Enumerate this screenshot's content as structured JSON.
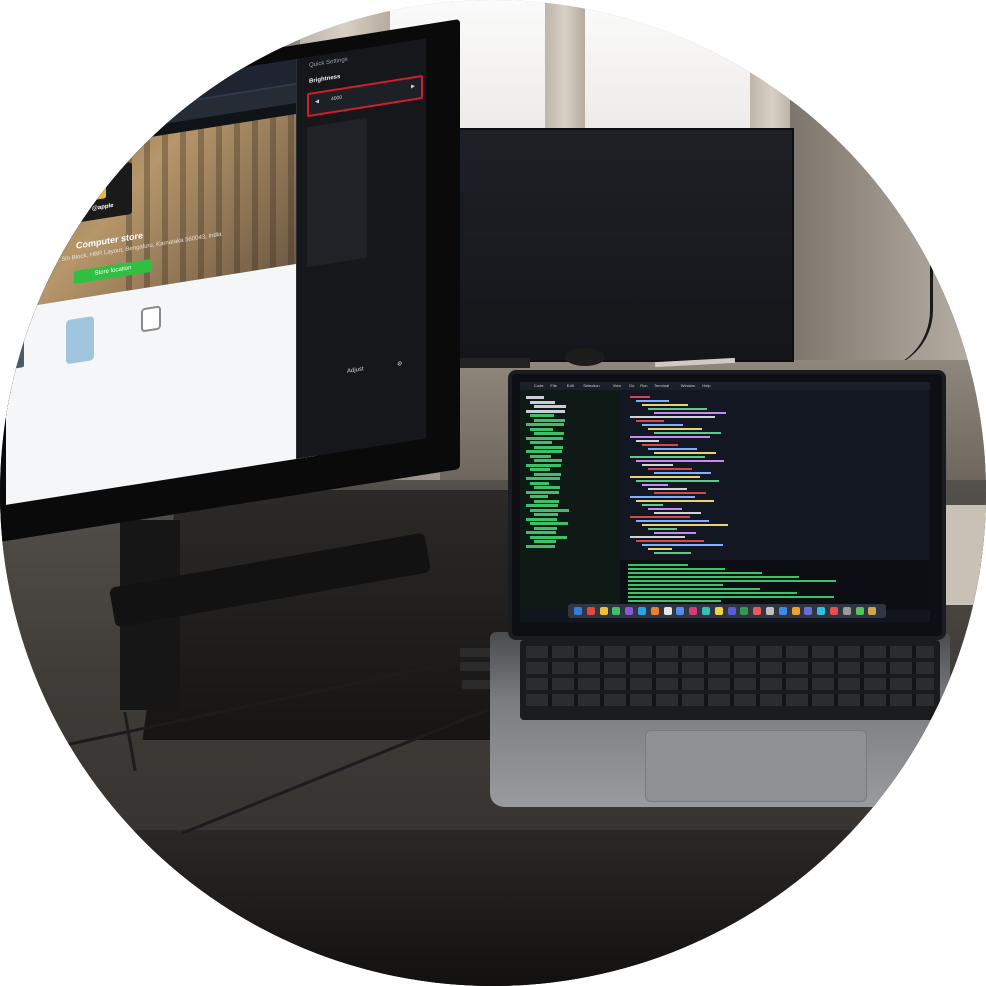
{
  "image": {
    "type": "photo"
  },
  "left_monitor": {
    "browser_tab_label": "Setting",
    "hero": {
      "brand": "@apple",
      "title": "Computer store",
      "address": "31, 4th Main Rd, 5th Block, HBR Layout, Bengaluru, Karnataka 560043, India",
      "button_label": "Store location"
    },
    "quick_settings": {
      "title": "Quick Settings",
      "label": "Brightness",
      "slider_value": "4000",
      "slider_left_icon": "chevron-left-icon",
      "slider_right_icon": "chevron-right-icon",
      "footer_text": "Adjust"
    }
  },
  "laptop": {
    "menu_items": [
      "Code",
      "File",
      "Edit",
      "Selection",
      "View",
      "Go",
      "Run",
      "Terminal",
      "Window",
      "Help"
    ],
    "dock_icon_colors": [
      "#2e7de1",
      "#e24b3b",
      "#f2c230",
      "#3fbf6a",
      "#8a56d6",
      "#27a3e8",
      "#f07f2d",
      "#e6e6e6",
      "#4f8df0",
      "#d93a7a",
      "#32c3b0",
      "#f5d04b",
      "#5b5bd6",
      "#2f9b53",
      "#e85b5b",
      "#c0c0c0",
      "#3b8be8",
      "#f0a030",
      "#6c6cd8",
      "#2dc1e0",
      "#eb4d4d",
      "#9a9a9a",
      "#58c45e",
      "#d0a64a"
    ]
  }
}
